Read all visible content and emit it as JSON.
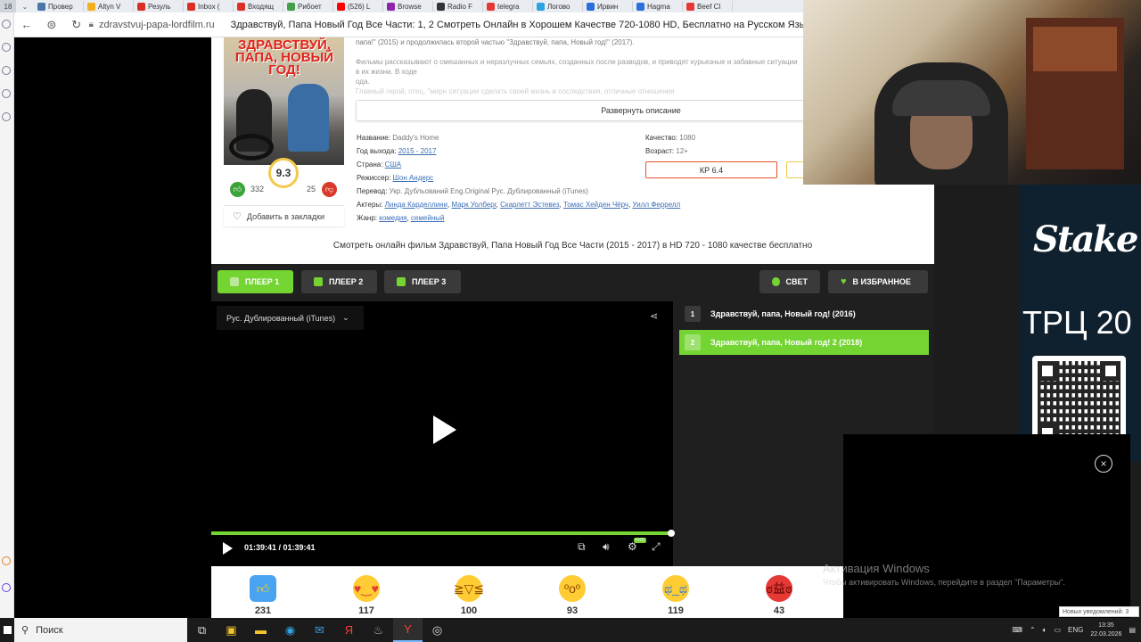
{
  "browser": {
    "tab_counter": "18",
    "tabs": [
      {
        "label": "Провер",
        "color": "#4a76a8"
      },
      {
        "label": "Altyn V",
        "color": "#f2b01e"
      },
      {
        "label": "Резуль",
        "color": "#d93025"
      },
      {
        "label": "Inbox (",
        "color": "#d93025"
      },
      {
        "label": "Входящ",
        "color": "#d93025"
      },
      {
        "label": "Рибоет",
        "color": "#43a047"
      },
      {
        "label": "(526) L",
        "color": "#ff0000"
      },
      {
        "label": "Browse",
        "color": "#8e24aa"
      },
      {
        "label": "Radio F",
        "color": "#333333"
      },
      {
        "label": "telegra",
        "color": "#e53935"
      },
      {
        "label": "Логово",
        "color": "#2aa3e0"
      },
      {
        "label": "Ирвин",
        "color": "#2a6fdb"
      },
      {
        "label": "Hagma",
        "color": "#2a6fdb"
      },
      {
        "label": "Beef Cl",
        "color": "#e53935"
      }
    ],
    "url": "zdravstvuj-papa-lordfilm.ru",
    "page_title": "Здравствуй, Папа Новый Год Все Части: 1, 2 Смотреть Онлайн в Хорошем Качестве 720-1080 HD, Бесплатно на Русском Язы"
  },
  "movie": {
    "poster_title": "ЗДРАВСТВУЙ, ПАПА, НОВЫЙ ГОД!",
    "rating": "9.3",
    "likes": "332",
    "dislikes": "25",
    "bookmark_label": "Добавить в закладки",
    "desc_line1": "папа!\" (2015) и продолжилась второй частью \"Здравствуй, папа, Новый год!\" (2017).",
    "desc_line2": "Фильмы рассказывают о смешанных и неразлучных семьях, созданных после разводов, и приводят курьезные и забавные ситуации в их жизни. В ходе",
    "desc_line2b": "ода.",
    "desc_line3": "Главный герой, отец, \"мирн ситуации сделать своей жизнь и последствия, отличные отношения",
    "expand_label": "Развернуть описание",
    "info": {
      "name_label": "Название:",
      "name_value": "Daddy's Home",
      "year_label": "Год выхода:",
      "year_value": "2015 - 2017",
      "country_label": "Страна:",
      "country_value": "США",
      "director_label": "Режиссер:",
      "director_value": "Шон Андерс",
      "translation_label": "Перевод:",
      "translation_value": "Укр. Дубльований Eng.Original Рус. Дублированный (iTunes)",
      "actors_label": "Актеры:",
      "actors": [
        "Линда Карделлини",
        "Марк Уолберг",
        "Скарлетт Эстевез",
        "Томас Хейден Чёрч",
        "Уилл Феррелл"
      ],
      "genre_label": "Жанр:",
      "genres": [
        "комедия",
        "семейный"
      ],
      "quality_label": "Качество:",
      "quality_value": "1080",
      "age_label": "Возраст:",
      "age_value": "12+",
      "kp": "КР 6.4"
    },
    "watch_title": "Смотреть онлайн фильм Здравствуй, Папа Новый Год Все Части (2015 - 2017) в HD 720 - 1080 качестве бесплатно"
  },
  "player": {
    "buttons": [
      "ПЛЕЕР 1",
      "ПЛЕЕР 2",
      "ПЛЕЕР 3"
    ],
    "light_label": "СВЕТ",
    "favorite_label": "В ИЗБРАННОЕ",
    "audio_track": "Рус. Дублированный (iTunes)",
    "time": "01:39:41 / 01:39:41",
    "progress": 1.0,
    "hd_badge": "FHD",
    "accent_color": "#74d432",
    "episodes": [
      {
        "num": "1",
        "title": "Здравствуй, папа, Новый год! (2016)",
        "active": false
      },
      {
        "num": "2",
        "title": "Здравствуй, папа, Новый год! 2 (2018)",
        "active": true
      }
    ]
  },
  "reactions": [
    {
      "icon": "thumbs-up",
      "count": "231"
    },
    {
      "icon": "heart-eyes",
      "count": "117"
    },
    {
      "icon": "laughing",
      "count": "100"
    },
    {
      "icon": "surprised",
      "count": "93"
    },
    {
      "icon": "crying",
      "count": "119"
    },
    {
      "icon": "angry",
      "count": "43"
    }
  ],
  "overlay": {
    "stake_logo": "Stake",
    "trc_text": "ТРЦ 20",
    "win_activate_title": "Активация Windows",
    "win_activate_sub": "Чтобы активировать Windows, перейдите в раздел \"Параметры\".",
    "notification": "Новых уведомлений: 3"
  },
  "taskbar": {
    "search_placeholder": "Поиск",
    "lang": "ENG",
    "time": "13:35",
    "date": "22.03.2026"
  }
}
